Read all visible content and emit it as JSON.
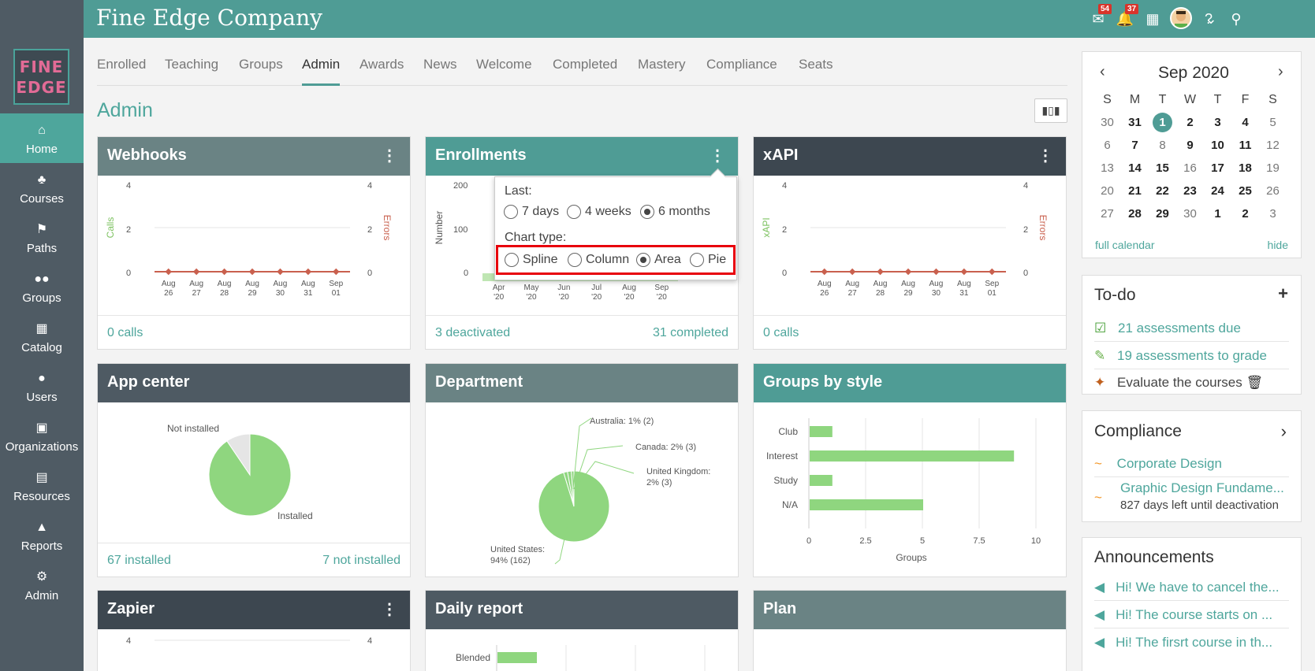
{
  "app": {
    "company": "Fine Edge Company",
    "logo_line1": "FINE",
    "logo_line2": "EDGE",
    "badge_messages": "54",
    "badge_notifications": "37"
  },
  "sidebar": {
    "items": [
      {
        "label": "Home",
        "icon": "home-icon"
      },
      {
        "label": "Courses",
        "icon": "courses-icon"
      },
      {
        "label": "Paths",
        "icon": "paths-icon"
      },
      {
        "label": "Groups",
        "icon": "groups-icon"
      },
      {
        "label": "Catalog",
        "icon": "catalog-icon"
      },
      {
        "label": "Users",
        "icon": "users-icon"
      },
      {
        "label": "Organizations",
        "icon": "organizations-icon"
      },
      {
        "label": "Resources",
        "icon": "resources-icon"
      },
      {
        "label": "Reports",
        "icon": "reports-icon"
      },
      {
        "label": "Admin",
        "icon": "admin-icon"
      }
    ]
  },
  "tabs": [
    "Enrolled",
    "Teaching",
    "Groups",
    "Admin",
    "Awards",
    "News",
    "Welcome",
    "Completed",
    "Mastery",
    "Compliance",
    "Seats"
  ],
  "page_title": "Admin",
  "widgets": {
    "webhooks": {
      "title": "Webhooks",
      "footer": "0 calls",
      "left_axis": "Calls",
      "right_axis": "Errors",
      "y_ticks": [
        "4",
        "2",
        "0"
      ],
      "x_ticks": [
        "Aug 26",
        "Aug 27",
        "Aug 28",
        "Aug 29",
        "Aug 30",
        "Aug 31",
        "Sep 01"
      ]
    },
    "enrollments": {
      "title": "Enrollments",
      "footer_left": "3 deactivated",
      "footer_right": "31 completed",
      "axis": "Number",
      "y_ticks": [
        "200",
        "100",
        "0"
      ],
      "x_ticks": [
        "Apr '20",
        "May '20",
        "Jun '20",
        "Jul '20",
        "Aug '20",
        "Sep '20"
      ]
    },
    "xapi": {
      "title": "xAPI",
      "footer": "0 calls",
      "left_axis": "xAPI",
      "right_axis": "Errors",
      "y_ticks": [
        "4",
        "2",
        "0"
      ],
      "x_ticks": [
        "Aug 26",
        "Aug 27",
        "Aug 28",
        "Aug 29",
        "Aug 30",
        "Aug 31",
        "Sep 01"
      ]
    },
    "app_center": {
      "title": "App center",
      "footer_left": "67 installed",
      "footer_right": "7 not installed",
      "label_installed": "Installed",
      "label_not_installed": "Not installed"
    },
    "department": {
      "title": "Department",
      "labels": [
        "Australia: 1% (2)",
        "Canada: 2% (3)",
        "United Kingdom:",
        "2% (3)",
        "United States:",
        "94% (162)"
      ]
    },
    "groups_by_style": {
      "title": "Groups by style",
      "xlabel": "Groups",
      "x_ticks": [
        "0",
        "2.5",
        "5",
        "7.5",
        "10"
      ]
    },
    "zapier": {
      "title": "Zapier",
      "y_ticks": [
        "4",
        "4"
      ]
    },
    "daily_report": {
      "title": "Daily report",
      "first_category": "Blended"
    },
    "plan": {
      "title": "Plan"
    }
  },
  "popup": {
    "last_label": "Last:",
    "last_options": [
      "7 days",
      "4 weeks",
      "6 months"
    ],
    "last_selected": "6 months",
    "chart_type_label": "Chart type:",
    "chart_options": [
      "Spline",
      "Column",
      "Area",
      "Pie"
    ],
    "chart_selected": "Area"
  },
  "calendar": {
    "month": "Sep 2020",
    "days": [
      "S",
      "M",
      "T",
      "W",
      "T",
      "F",
      "S"
    ],
    "weeks": [
      [
        "30",
        "31",
        "1",
        "2",
        "3",
        "4",
        "5"
      ],
      [
        "6",
        "7",
        "8",
        "9",
        "10",
        "11",
        "12"
      ],
      [
        "13",
        "14",
        "15",
        "16",
        "17",
        "18",
        "19"
      ],
      [
        "20",
        "21",
        "22",
        "23",
        "24",
        "25",
        "26"
      ],
      [
        "27",
        "28",
        "29",
        "30",
        "1",
        "2",
        "3"
      ]
    ],
    "today": "1",
    "full_calendar": "full calendar",
    "hide": "hide"
  },
  "todo": {
    "title": "To-do",
    "items": [
      "21 assessments due",
      "19 assessments to grade",
      "Evaluate the courses"
    ]
  },
  "compliance": {
    "title": "Compliance",
    "items": [
      "Corporate Design",
      "Graphic Design Fundame..."
    ],
    "sub": "827 days left until deactivation"
  },
  "announcements": {
    "title": "Announcements",
    "items": [
      "Hi! We have to cancel the...",
      "Hi! The course starts on ...",
      "Hi! The firsrt course in th..."
    ]
  },
  "chart_data": [
    {
      "type": "line",
      "title": "Webhooks",
      "x": [
        "Aug 26",
        "Aug 27",
        "Aug 28",
        "Aug 29",
        "Aug 30",
        "Aug 31",
        "Sep 01"
      ],
      "series": [
        {
          "name": "Calls",
          "values": [
            0,
            0,
            0,
            0,
            0,
            0,
            0
          ]
        },
        {
          "name": "Errors",
          "values": [
            0,
            0,
            0,
            0,
            0,
            0,
            0
          ]
        }
      ],
      "ylim": [
        0,
        4
      ],
      "ylabel": "Calls",
      "y2label": "Errors"
    },
    {
      "type": "area",
      "title": "Enrollments",
      "x": [
        "Apr '20",
        "May '20",
        "Jun '20",
        "Jul '20",
        "Aug '20",
        "Sep '20"
      ],
      "ylim": [
        0,
        200
      ],
      "ylabel": "Number"
    },
    {
      "type": "line",
      "title": "xAPI",
      "x": [
        "Aug 26",
        "Aug 27",
        "Aug 28",
        "Aug 29",
        "Aug 30",
        "Aug 31",
        "Sep 01"
      ],
      "series": [
        {
          "name": "xAPI",
          "values": [
            0,
            0,
            0,
            0,
            0,
            0,
            0
          ]
        },
        {
          "name": "Errors",
          "values": [
            0,
            0,
            0,
            0,
            0,
            0,
            0
          ]
        }
      ],
      "ylim": [
        0,
        4
      ],
      "ylabel": "xAPI",
      "y2label": "Errors"
    },
    {
      "type": "pie",
      "title": "App center",
      "categories": [
        "Installed",
        "Not installed"
      ],
      "values": [
        67,
        7
      ]
    },
    {
      "type": "pie",
      "title": "Department",
      "categories": [
        "United States",
        "United Kingdom",
        "Canada",
        "Australia"
      ],
      "values": [
        162,
        3,
        3,
        2
      ]
    },
    {
      "type": "bar",
      "title": "Groups by style",
      "categories": [
        "Club",
        "Interest",
        "Study",
        "N/A"
      ],
      "values": [
        1,
        9,
        1,
        5
      ],
      "xlabel": "Groups",
      "xlim": [
        0,
        10
      ]
    }
  ],
  "colors": {
    "accent": "#4ea69c",
    "bar": "#8fd67f",
    "line": "#c9604e"
  }
}
